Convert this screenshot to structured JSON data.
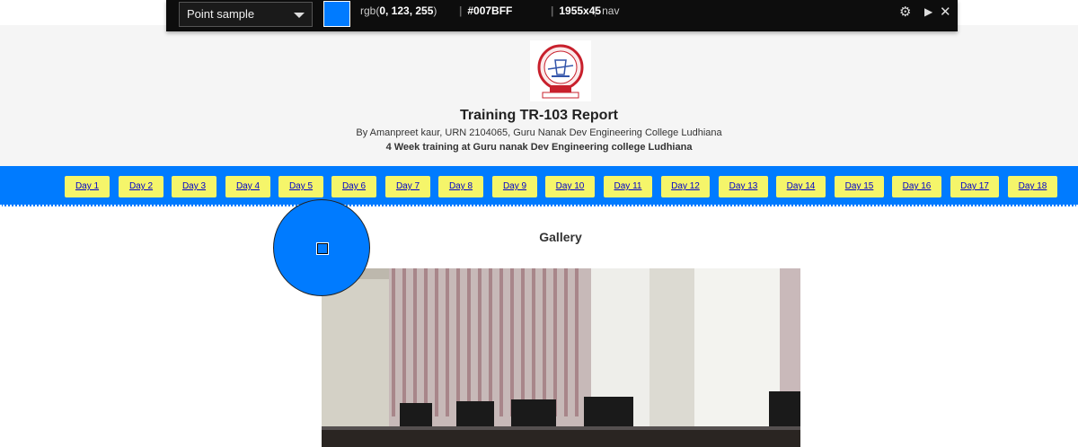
{
  "picker": {
    "mode": "Point sample",
    "rgb_prefix": "rgb(",
    "rgb_values": "0, 123, 255",
    "rgb_suffix": ")",
    "hex": "#007BFF",
    "size": "1955x45",
    "tag": "nav",
    "swatch_color": "#007BFF"
  },
  "header": {
    "title": "Training TR-103 Report",
    "byline": "By Amanpreet kaur, URN 2104065, Guru Nanak Dev Engineering College Ludhiana",
    "subline": "4 Week training at Guru nanak Dev Engineering college Ludhiana"
  },
  "nav": {
    "items": [
      "Day 1",
      "Day 2",
      "Day 3",
      "Day 4",
      "Day 5",
      "Day 6",
      "Day 7",
      "Day 8",
      "Day 9",
      "Day 10",
      "Day 11",
      "Day 12",
      "Day 13",
      "Day 14",
      "Day 15",
      "Day 16",
      "Day 17",
      "Day 18"
    ]
  },
  "main": {
    "gallery_title": "Gallery"
  },
  "colors": {
    "nav_bg": "#007BFF",
    "nav_button_bg": "#f5f56a",
    "header_bg": "#f5f5f5"
  }
}
